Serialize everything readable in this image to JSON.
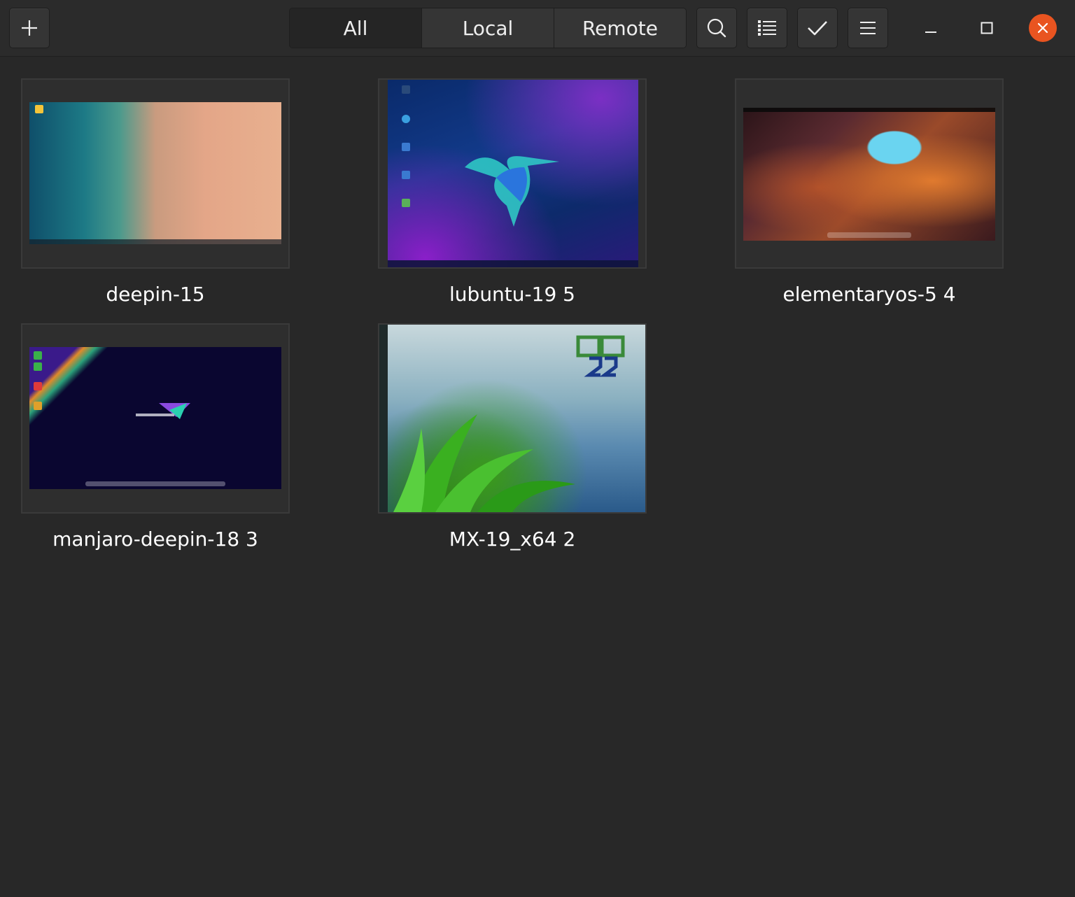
{
  "header": {
    "tabs": [
      {
        "label": "All",
        "active": true
      },
      {
        "label": "Local",
        "active": false
      },
      {
        "label": "Remote",
        "active": false
      }
    ],
    "icons": {
      "new": "plus-icon",
      "search": "search-icon",
      "list_view": "list-view-icon",
      "selection": "checkmark-icon",
      "menu": "hamburger-menu-icon",
      "minimize": "minimize-icon",
      "maximize": "maximize-icon",
      "close": "close-icon"
    },
    "close_color": "#e95420"
  },
  "machines": [
    {
      "name": "deepin-15"
    },
    {
      "name": "lubuntu-19 5"
    },
    {
      "name": "elementaryos-5 4"
    },
    {
      "name": "manjaro-deepin-18 3"
    },
    {
      "name": "MX-19_x64 2"
    }
  ]
}
